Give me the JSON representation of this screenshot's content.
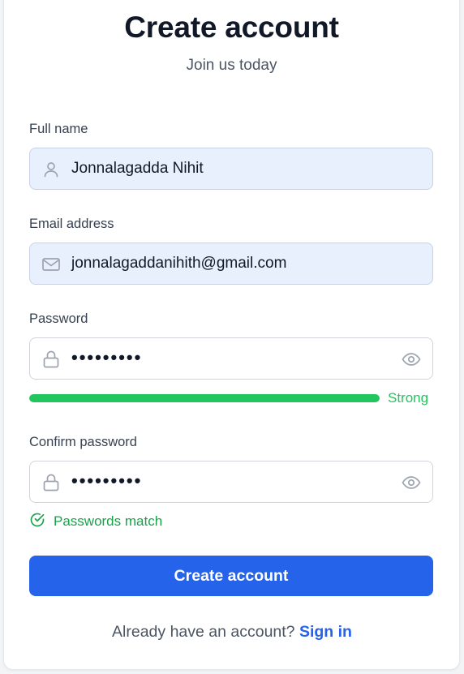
{
  "header": {
    "title": "Create account",
    "subtitle": "Join us today"
  },
  "form": {
    "full_name": {
      "label": "Full name",
      "value": "Jonnalagadda Nihit",
      "icon": "user-icon"
    },
    "email": {
      "label": "Email address",
      "value": "jonnalagaddanihith@gmail.com",
      "icon": "mail-icon"
    },
    "password": {
      "label": "Password",
      "masked_value": "•••••••••",
      "icon": "lock-icon",
      "toggle_icon": "eye-icon",
      "strength": {
        "label": "Strong",
        "level": 1.0,
        "color": "#22c55e"
      }
    },
    "confirm_password": {
      "label": "Confirm password",
      "masked_value": "•••••••••",
      "icon": "lock-icon",
      "toggle_icon": "eye-icon",
      "match_message": "Passwords match",
      "match_icon": "check-circle-icon",
      "match_color": "#16a34a"
    },
    "submit_label": "Create account"
  },
  "footer": {
    "prompt": "Already have an account?",
    "link_label": "Sign in"
  },
  "colors": {
    "primary": "#2563eb",
    "autofill_bg": "#e8f0fe",
    "success": "#22c55e"
  }
}
